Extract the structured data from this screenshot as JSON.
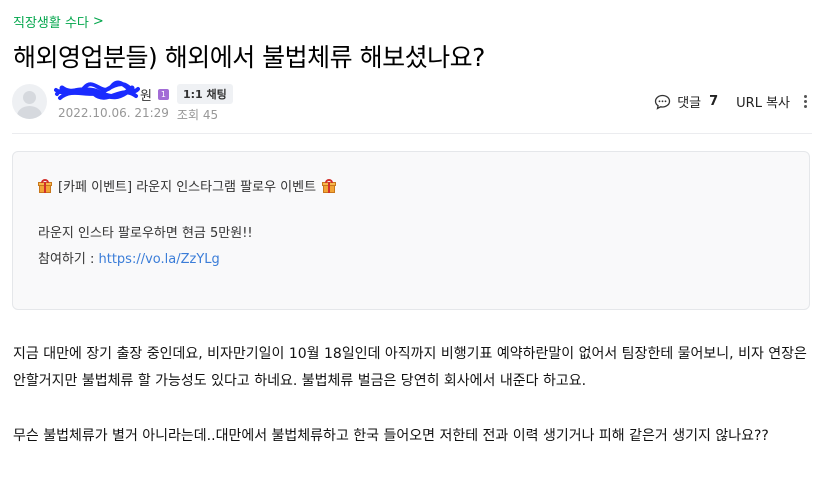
{
  "board": {
    "name": "직장생활 수다",
    "chevron": ">"
  },
  "post": {
    "title": "해외영업분들) 해외에서 불법체류 해보셨나요?",
    "author_suffix": "원",
    "level_badge": "1",
    "chat_chip": "1:1 채팅",
    "date": "2022.10.06. 21:29",
    "views": "조회 45"
  },
  "tools": {
    "comment_label": "댓글",
    "comment_count": "7",
    "url_copy": "URL 복사"
  },
  "notice": {
    "title": "[카페 이벤트] 라운지 인스타그램 팔로우 이벤트",
    "line1": "라운지 인스타 팔로우하면 현금 5만원!!",
    "line2_label": "참여하기 : ",
    "line2_link": "https://vo.la/ZzYLg"
  },
  "content": {
    "para1": "지금 대만에 장기 출장 중인데요, 비자만기일이 10월 18일인데 아직까지 비행기표 예약하란말이 없어서 팀장한테 물어보니, 비자 연장은 안할거지만 불법체류 할 가능성도 있다고 하네요. 불법체류 벌금은 당연히 회사에서 내준다 하고요.",
    "para2": "무슨 불법체류가 별거 아니라는데..대만에서 불법체류하고 한국 들어오면 저한테 전과 이력 생기거나 피해 같은거 생기지 않나요??"
  },
  "colors": {
    "accent": "#03a64c",
    "link": "#3b7dd8",
    "badge": "#a26cd6"
  },
  "icons": [
    "chevron-right-icon",
    "default-avatar-icon",
    "comment-icon",
    "more-vertical-icon",
    "gift-icon"
  ]
}
